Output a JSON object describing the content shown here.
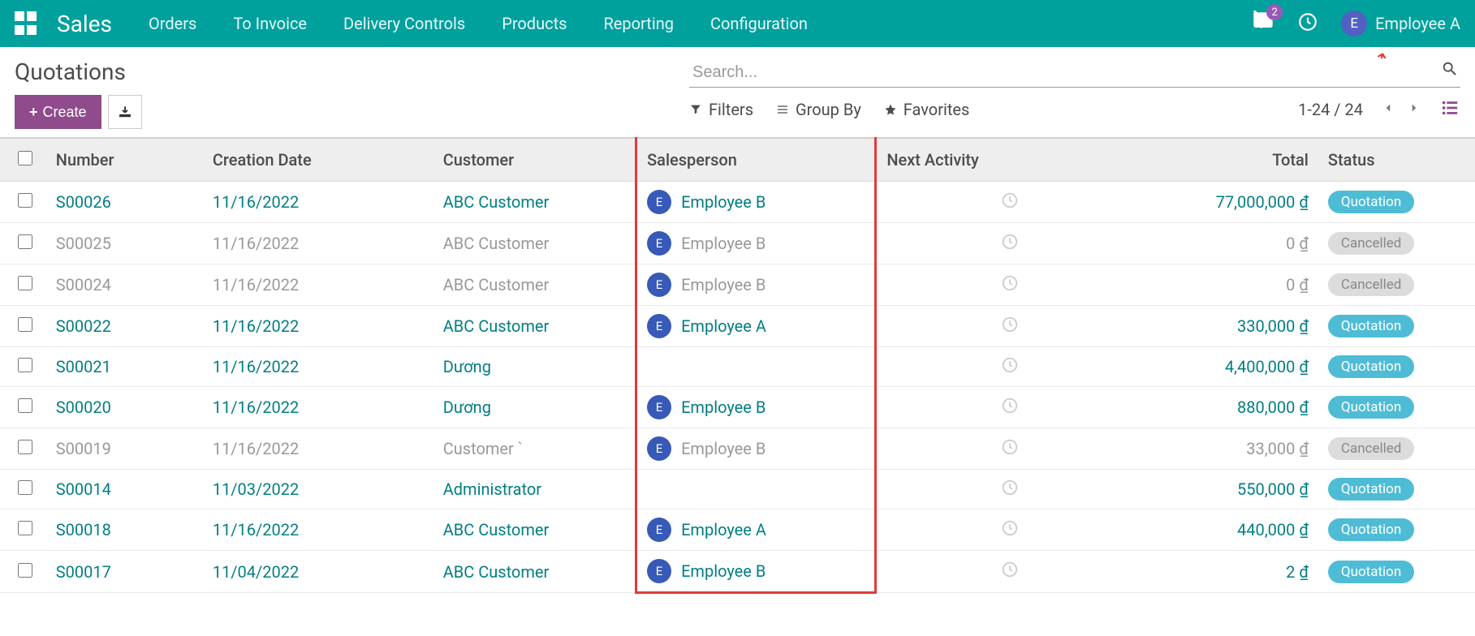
{
  "navbar": {
    "app_name": "Sales",
    "menu": [
      "Orders",
      "To Invoice",
      "Delivery Controls",
      "Products",
      "Reporting",
      "Configuration"
    ],
    "badge": "2",
    "user": {
      "initial": "E",
      "name": "Employee A"
    }
  },
  "cp": {
    "title": "Quotations",
    "create_label": "Create",
    "search_placeholder": "Search...",
    "filters_label": "Filters",
    "groupby_label": "Group By",
    "favorites_label": "Favorites",
    "pager": "1-24 / 24"
  },
  "table": {
    "headers": {
      "number": "Number",
      "date": "Creation Date",
      "customer": "Customer",
      "salesperson": "Salesperson",
      "activity": "Next Activity",
      "total": "Total",
      "status": "Status"
    },
    "rows": [
      {
        "number": "S00026",
        "date": "11/16/2022",
        "customer": "ABC Customer",
        "sp_initial": "E",
        "sp_name": "Employee B",
        "total": "77,000,000 ₫",
        "status": "Quotation",
        "cancelled": false
      },
      {
        "number": "S00025",
        "date": "11/16/2022",
        "customer": "ABC Customer",
        "sp_initial": "E",
        "sp_name": "Employee B",
        "total": "0 ₫",
        "status": "Cancelled",
        "cancelled": true
      },
      {
        "number": "S00024",
        "date": "11/16/2022",
        "customer": "ABC Customer",
        "sp_initial": "E",
        "sp_name": "Employee B",
        "total": "0 ₫",
        "status": "Cancelled",
        "cancelled": true
      },
      {
        "number": "S00022",
        "date": "11/16/2022",
        "customer": "ABC Customer",
        "sp_initial": "E",
        "sp_name": "Employee A",
        "total": "330,000 ₫",
        "status": "Quotation",
        "cancelled": false
      },
      {
        "number": "S00021",
        "date": "11/16/2022",
        "customer": "Dương",
        "sp_initial": "",
        "sp_name": "",
        "total": "4,400,000 ₫",
        "status": "Quotation",
        "cancelled": false
      },
      {
        "number": "S00020",
        "date": "11/16/2022",
        "customer": "Dương",
        "sp_initial": "E",
        "sp_name": "Employee B",
        "total": "880,000 ₫",
        "status": "Quotation",
        "cancelled": false
      },
      {
        "number": "S00019",
        "date": "11/16/2022",
        "customer": "Customer `",
        "sp_initial": "E",
        "sp_name": "Employee B",
        "total": "33,000 ₫",
        "status": "Cancelled",
        "cancelled": true
      },
      {
        "number": "S00014",
        "date": "11/03/2022",
        "customer": "Administrator",
        "sp_initial": "",
        "sp_name": "",
        "total": "550,000 ₫",
        "status": "Quotation",
        "cancelled": false
      },
      {
        "number": "S00018",
        "date": "11/16/2022",
        "customer": "ABC Customer",
        "sp_initial": "E",
        "sp_name": "Employee A",
        "total": "440,000 ₫",
        "status": "Quotation",
        "cancelled": false
      },
      {
        "number": "S00017",
        "date": "11/04/2022",
        "customer": "ABC Customer",
        "sp_initial": "E",
        "sp_name": "Employee B",
        "total": "2 ₫",
        "status": "Quotation",
        "cancelled": false
      }
    ]
  }
}
